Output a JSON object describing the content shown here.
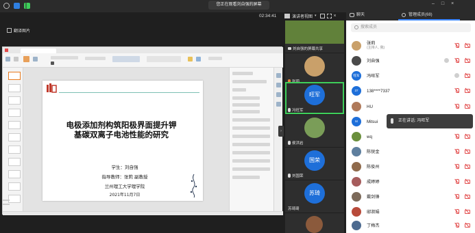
{
  "topbar": {
    "banner": "您正在观看刘自强的屏幕",
    "clock": "02:34:41",
    "presenter_view": "演讲者视图",
    "colors": {
      "shield": "#2f7fe0",
      "wifi": "#3ecf5a"
    }
  },
  "share_toolbar": {
    "label": "翻译图片"
  },
  "slide": {
    "title": "电极添加剂构筑阳极界面提升钾基碳双离子电池性能的研究",
    "student": "学生：刘自强",
    "advisor": "指导教师：张莉  副教授",
    "school": "兰州理工大学理学院",
    "date": "2021年11月7日"
  },
  "videos": [
    {
      "label": "刘自强的屏幕共享",
      "kind": "photo",
      "color": "#6a8f3c"
    },
    {
      "label": "张莉",
      "kind": "photo",
      "color": "#c9a06a"
    },
    {
      "label": "冯旺军",
      "kind": "text",
      "text": "旺军",
      "color": "#1e6fd9",
      "active": true
    },
    {
      "label": "侯洪岩",
      "kind": "photo",
      "color": "#7a9d58"
    },
    {
      "label": "刘国荣",
      "kind": "text",
      "text": "国荣",
      "color": "#1e6fd9"
    },
    {
      "label": "苏琦琦",
      "kind": "text",
      "text": "苏琦",
      "color": "#1e6fd9"
    },
    {
      "label": "",
      "kind": "photo",
      "color": "#8b5a3c"
    }
  ],
  "panel": {
    "tab_chat": "聊天",
    "tab_members": "管理成员(68)",
    "search_placeholder": "搜索成员",
    "members": [
      {
        "name": "张莉",
        "sub": "(主持人, 我)",
        "avatar": "photo",
        "color": "#c9a06a"
      },
      {
        "name": "刘自强",
        "sub": "",
        "avatar": "photo",
        "color": "#4a4a4a"
      },
      {
        "name": "冯旺军",
        "sub": "",
        "avatar": "text",
        "text": "旺军",
        "color": "#1e6fd9"
      },
      {
        "name": "138****7337",
        "sub": "",
        "avatar": "text",
        "text": "37",
        "color": "#1e6fd9"
      },
      {
        "name": "HU",
        "sub": "",
        "avatar": "photo",
        "color": "#b07a5a"
      },
      {
        "name": "Mitsui",
        "sub": "",
        "avatar": "text",
        "text": "M",
        "color": "#1e6fd9"
      },
      {
        "name": "wq",
        "sub": "",
        "avatar": "photo",
        "color": "#6a8f3c"
      },
      {
        "name": "陈锐金",
        "sub": "",
        "avatar": "photo",
        "color": "#5e7f9e"
      },
      {
        "name": "陈俊州",
        "sub": "",
        "avatar": "photo",
        "color": "#8f6a4c"
      },
      {
        "name": "成婷婷",
        "sub": "",
        "avatar": "photo",
        "color": "#a65c5c"
      },
      {
        "name": "戴剑锋",
        "sub": "",
        "avatar": "photo",
        "color": "#7c6a5a"
      },
      {
        "name": "邸淑娟",
        "sub": "",
        "avatar": "photo",
        "color": "#b84a3a"
      },
      {
        "name": "丁梅杰",
        "sub": "",
        "avatar": "photo",
        "color": "#4c6a8f"
      }
    ]
  },
  "toast": {
    "text": "正在讲话: 冯旺军"
  }
}
